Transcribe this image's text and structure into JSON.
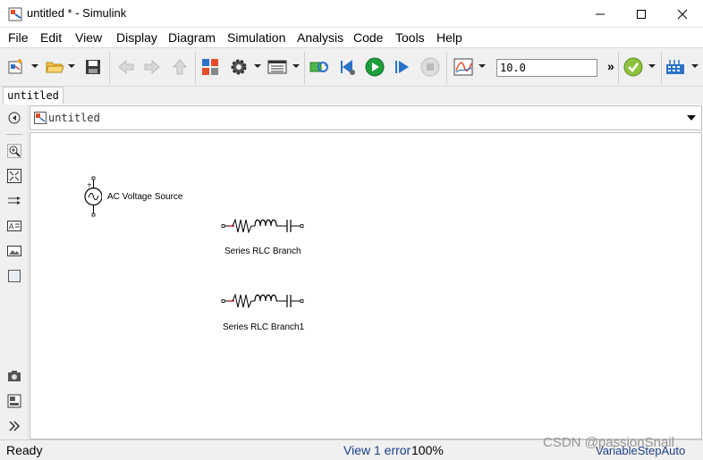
{
  "window": {
    "title": "untitled * - Simulink",
    "minimize_icon": "minimize-icon",
    "maximize_icon": "maximize-icon",
    "close_icon": "close-icon"
  },
  "menu": [
    "File",
    "Edit",
    "View",
    "Display",
    "Diagram",
    "Simulation",
    "Analysis",
    "Code",
    "Tools",
    "Help"
  ],
  "toolbar": {
    "stop_time": "10.0",
    "more_label": "»",
    "icons": [
      "new-model-icon",
      "open-icon",
      "save-icon",
      "back-icon",
      "forward-icon",
      "up-icon",
      "library-browser-icon",
      "model-config-icon",
      "model-explorer-icon",
      "update-diagram-icon",
      "step-back-icon",
      "run-icon",
      "step-forward-icon",
      "stop-icon",
      "data-inspector-icon",
      "check-icon",
      "build-icon"
    ]
  },
  "tabs": [
    {
      "label": "untitled"
    }
  ],
  "address": {
    "model": "untitled"
  },
  "blocks": [
    {
      "label": "AC Voltage Source",
      "icon": "ac-voltage-source-icon"
    },
    {
      "label": "Series RLC Branch",
      "icon": "rlc-branch-icon"
    },
    {
      "label": "Series RLC Branch1",
      "icon": "rlc-branch-icon"
    }
  ],
  "status": {
    "ready": "Ready",
    "error": "View 1 error",
    "zoom": "100%",
    "solver": "VariableStepAuto"
  },
  "watermark": "CSDN @passionSnail",
  "colors": {
    "run_green": "#1e9e3a",
    "status_link": "#1a3f8a",
    "toolbar_bg": "#f0f0f0"
  }
}
